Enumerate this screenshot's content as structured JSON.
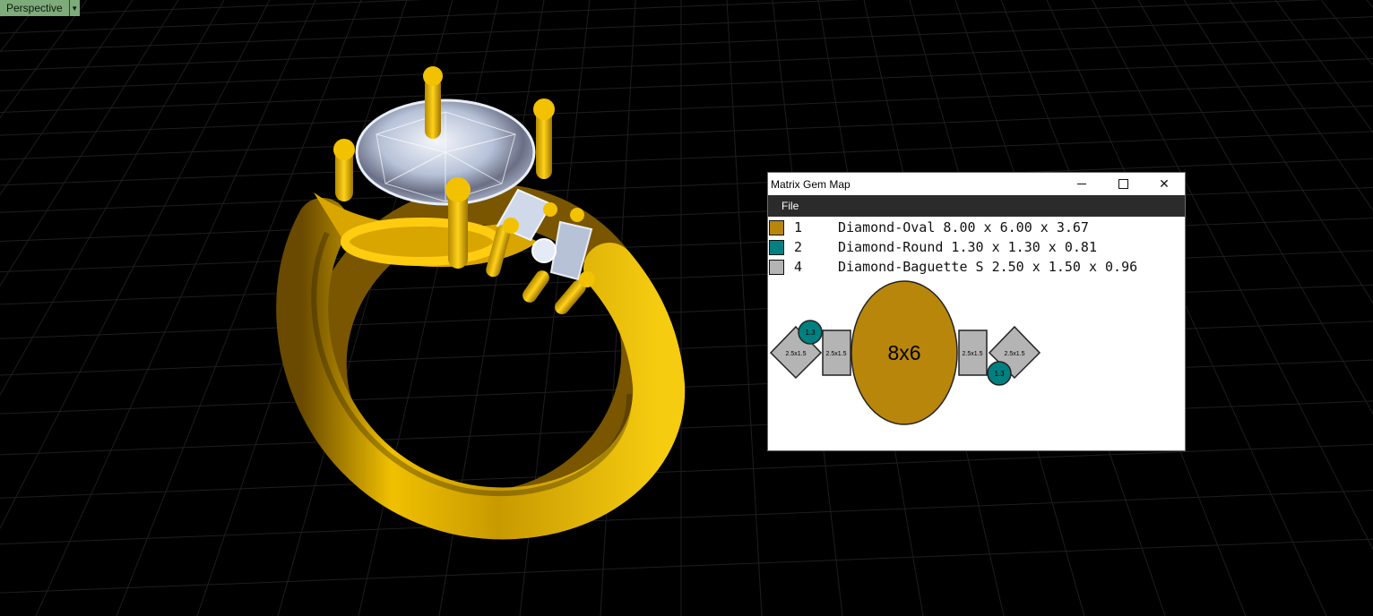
{
  "viewport": {
    "label": "Perspective",
    "dropdown_icon": "triangle-down-icon",
    "background": "#000000",
    "grid_color": "#1e1e1e"
  },
  "colors": {
    "gold": "#E6B000",
    "gold_dark": "#8A6400",
    "diamond": "#D8E2F2",
    "gem_oval": "#B8860B",
    "gem_round": "#008080",
    "gem_baguette": "#B4B4B4"
  },
  "gem_window": {
    "title": "Matrix Gem Map",
    "controls": {
      "minimize": "minimize-icon",
      "maximize": "maximize-icon",
      "close": "close-icon"
    },
    "menu": [
      "File"
    ],
    "legend": [
      {
        "color": "#B8860B",
        "count": "1",
        "description": "Diamond-Oval 8.00 x 6.00 x 3.67"
      },
      {
        "color": "#008080",
        "count": "2",
        "description": "Diamond-Round 1.30 x 1.30 x 0.81"
      },
      {
        "color": "#B4B4B4",
        "count": "4",
        "description": "Diamond-Baguette S 2.50 x 1.50 x 0.96"
      }
    ],
    "diagram": {
      "center_label": "8x6",
      "baguette_label": "2.5x1.5",
      "round_label": "1.3"
    }
  }
}
